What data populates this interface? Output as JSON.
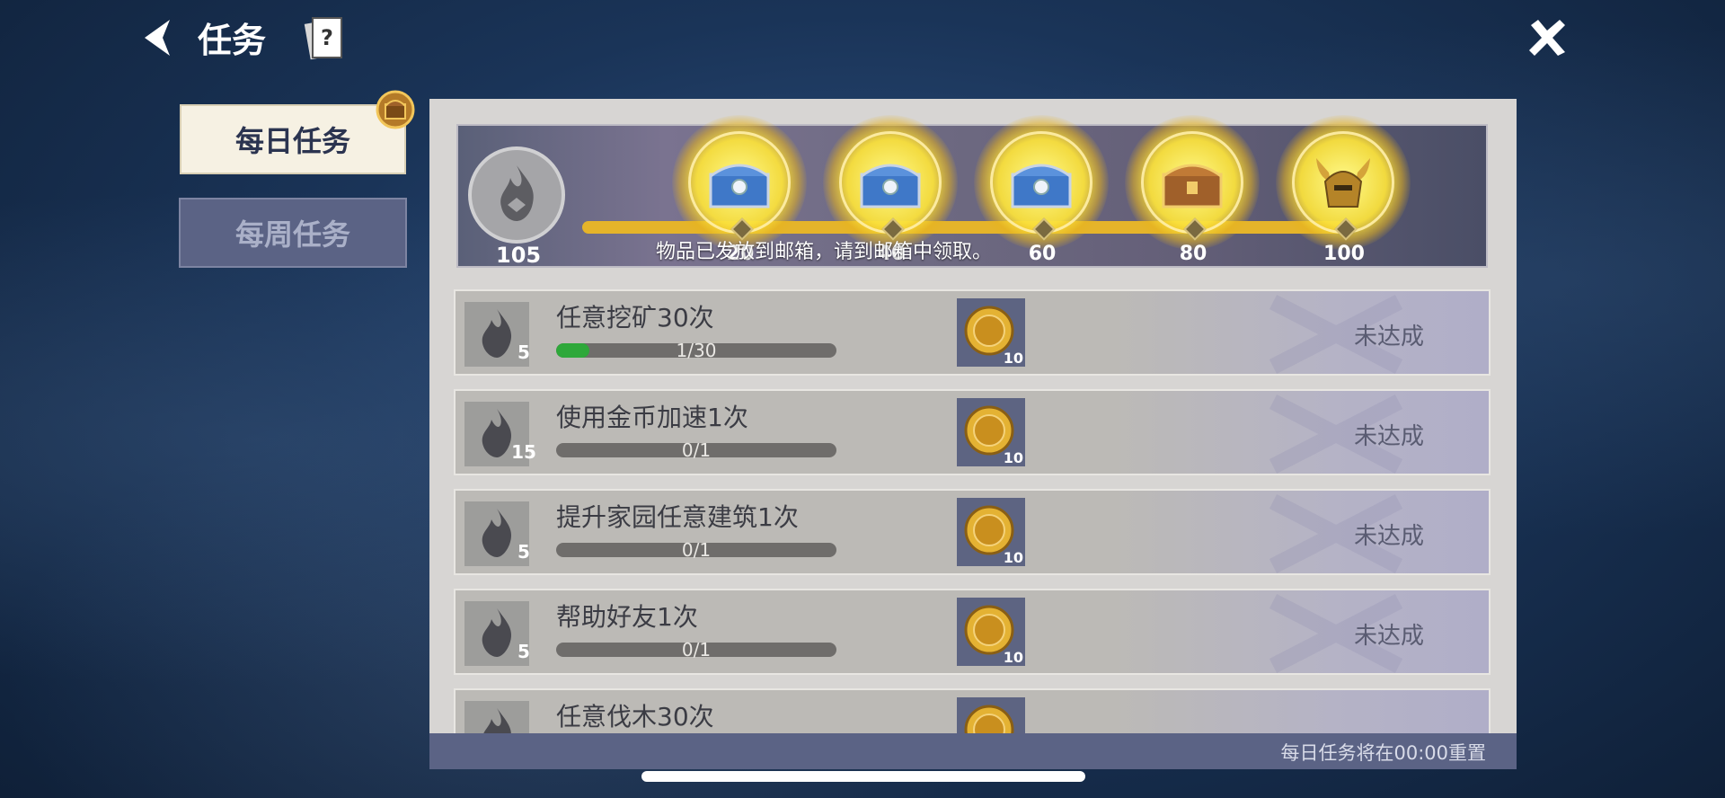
{
  "header": {
    "title": "任务"
  },
  "tabs": [
    {
      "label": "每日任务",
      "active": true
    },
    {
      "label": "每周任务",
      "active": false
    }
  ],
  "progress": {
    "current": "105",
    "fraction": 1.0,
    "milestones": [
      {
        "value": "20",
        "reward": "blue-chest"
      },
      {
        "value": "40",
        "reward": "blue-chest"
      },
      {
        "value": "60",
        "reward": "blue-chest"
      },
      {
        "value": "80",
        "reward": "gold-chest"
      },
      {
        "value": "100",
        "reward": "horned-helmet"
      }
    ],
    "toast": "物品已发放到邮箱，请到邮箱中领取。"
  },
  "tasks": [
    {
      "name": "任意挖矿30次",
      "points": "5",
      "progress_text": "1/30",
      "progress": 0.033,
      "reward_count": "10",
      "status": "未达成"
    },
    {
      "name": "使用金币加速1次",
      "points": "15",
      "progress_text": "0/1",
      "progress": 0,
      "reward_count": "10",
      "status": "未达成"
    },
    {
      "name": "提升家园任意建筑1次",
      "points": "5",
      "progress_text": "0/1",
      "progress": 0,
      "reward_count": "10",
      "status": "未达成"
    },
    {
      "name": "帮助好友1次",
      "points": "5",
      "progress_text": "0/1",
      "progress": 0,
      "reward_count": "10",
      "status": "未达成"
    },
    {
      "name": "任意伐木30次",
      "points": "",
      "progress_text": "",
      "progress": 0,
      "reward_count": "",
      "status": ""
    }
  ],
  "footer": {
    "reset_text": "每日任务将在00:00重置"
  },
  "colors": {
    "accent_gold": "#e5b42a",
    "progress_green": "#2ea83a",
    "tab_active_bg": "#f6f1e3",
    "tab_inactive_bg": "#5b6385"
  }
}
